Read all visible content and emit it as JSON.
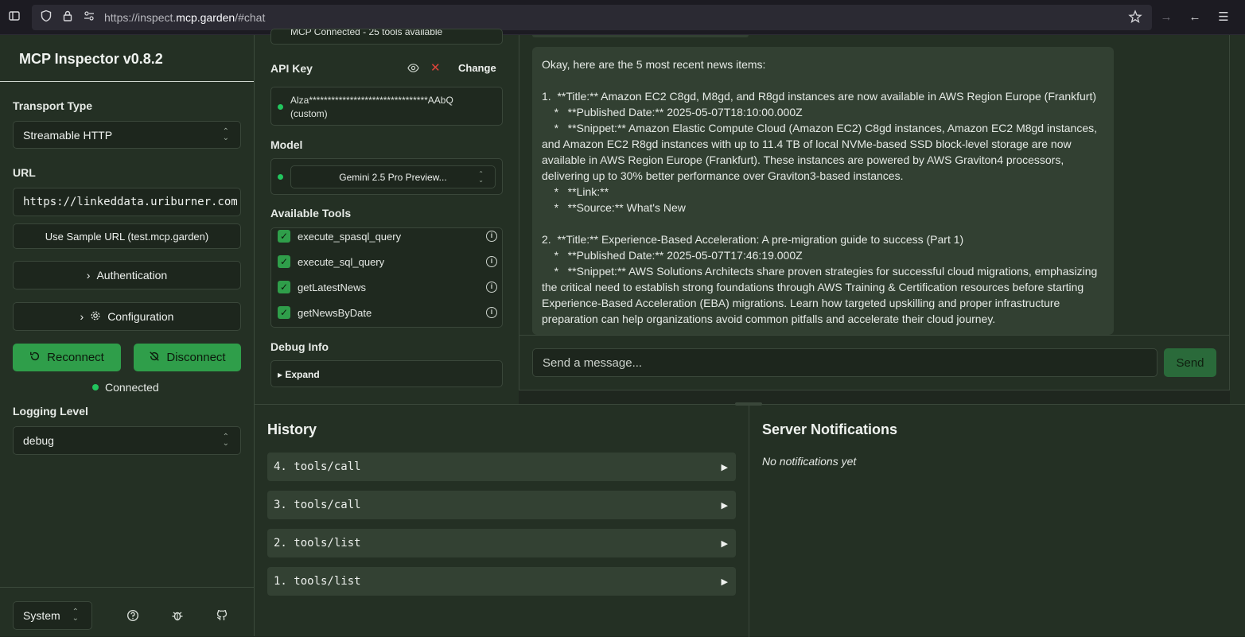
{
  "browser": {
    "url_prefix": "https://inspect.",
    "url_domain": "mcp.garden",
    "url_suffix": "/#chat"
  },
  "sidebar": {
    "title": "MCP Inspector v0.8.2",
    "transport_label": "Transport Type",
    "transport_value": "Streamable HTTP",
    "url_label": "URL",
    "url_value": "https://linkeddata.uriburner.com",
    "sample_url_button": "Use Sample URL (test.mcp.garden)",
    "authentication_label": "Authentication",
    "configuration_label": "Configuration",
    "reconnect_label": "Reconnect",
    "disconnect_label": "Disconnect",
    "status": "Connected",
    "logging_label": "Logging Level",
    "logging_value": "debug",
    "theme_value": "System"
  },
  "middle": {
    "connected_partial": "MCP Connected - 25 tools available",
    "api_key_label": "API Key",
    "api_key_change": "Change",
    "api_key_value": "Alza********************************AAbQ",
    "api_key_note": "(custom)",
    "model_label": "Model",
    "model_value": "Gemini 2.5 Pro Preview...",
    "tools_label": "Available Tools",
    "tools": [
      {
        "name": "execute_spasql_query"
      },
      {
        "name": "execute_sql_query"
      },
      {
        "name": "getLatestNews"
      },
      {
        "name": "getNewsByDate"
      }
    ],
    "debug_label": "Debug Info",
    "expand_label": "▸ Expand"
  },
  "chat": {
    "message": "Okay, here are the 5 most recent news items:\n\n1.  **Title:** Amazon EC2 C8gd, M8gd, and R8gd instances are now available in AWS Region Europe (Frankfurt)\n    *   **Published Date:** 2025-05-07T18:10:00.000Z\n    *   **Snippet:** Amazon Elastic Compute Cloud (Amazon EC2) C8gd instances, Amazon EC2 M8gd instances, and Amazon EC2 R8gd instances with up to 11.4 TB of local NVMe-based SSD block-level storage are now available in AWS Region Europe (Frankfurt). These instances are powered by AWS Graviton4 processors, delivering up to 30% better performance over Graviton3-based instances.\n    *   **Link:**\n    *   **Source:** What's New\n\n2.  **Title:** Experience-Based Acceleration: A pre-migration guide to success (Part 1)\n    *   **Published Date:** 2025-05-07T17:46:19.000Z\n    *   **Snippet:** AWS Solutions Architects share proven strategies for successful cloud migrations, emphasizing the critical need to establish strong foundations through AWS Training & Certification resources before starting Experience-Based Acceleration (EBA) migrations. Learn how targeted upskilling and proper infrastructure preparation can help organizations avoid common pitfalls and accelerate their cloud journey.",
    "input_placeholder": "Send a message...",
    "send_label": "Send"
  },
  "history": {
    "title": "History",
    "items": [
      {
        "label": "4. tools/call"
      },
      {
        "label": "3. tools/call"
      },
      {
        "label": "2. tools/list"
      },
      {
        "label": "1. tools/list"
      }
    ]
  },
  "notifications": {
    "title": "Server Notifications",
    "empty": "No notifications yet"
  }
}
